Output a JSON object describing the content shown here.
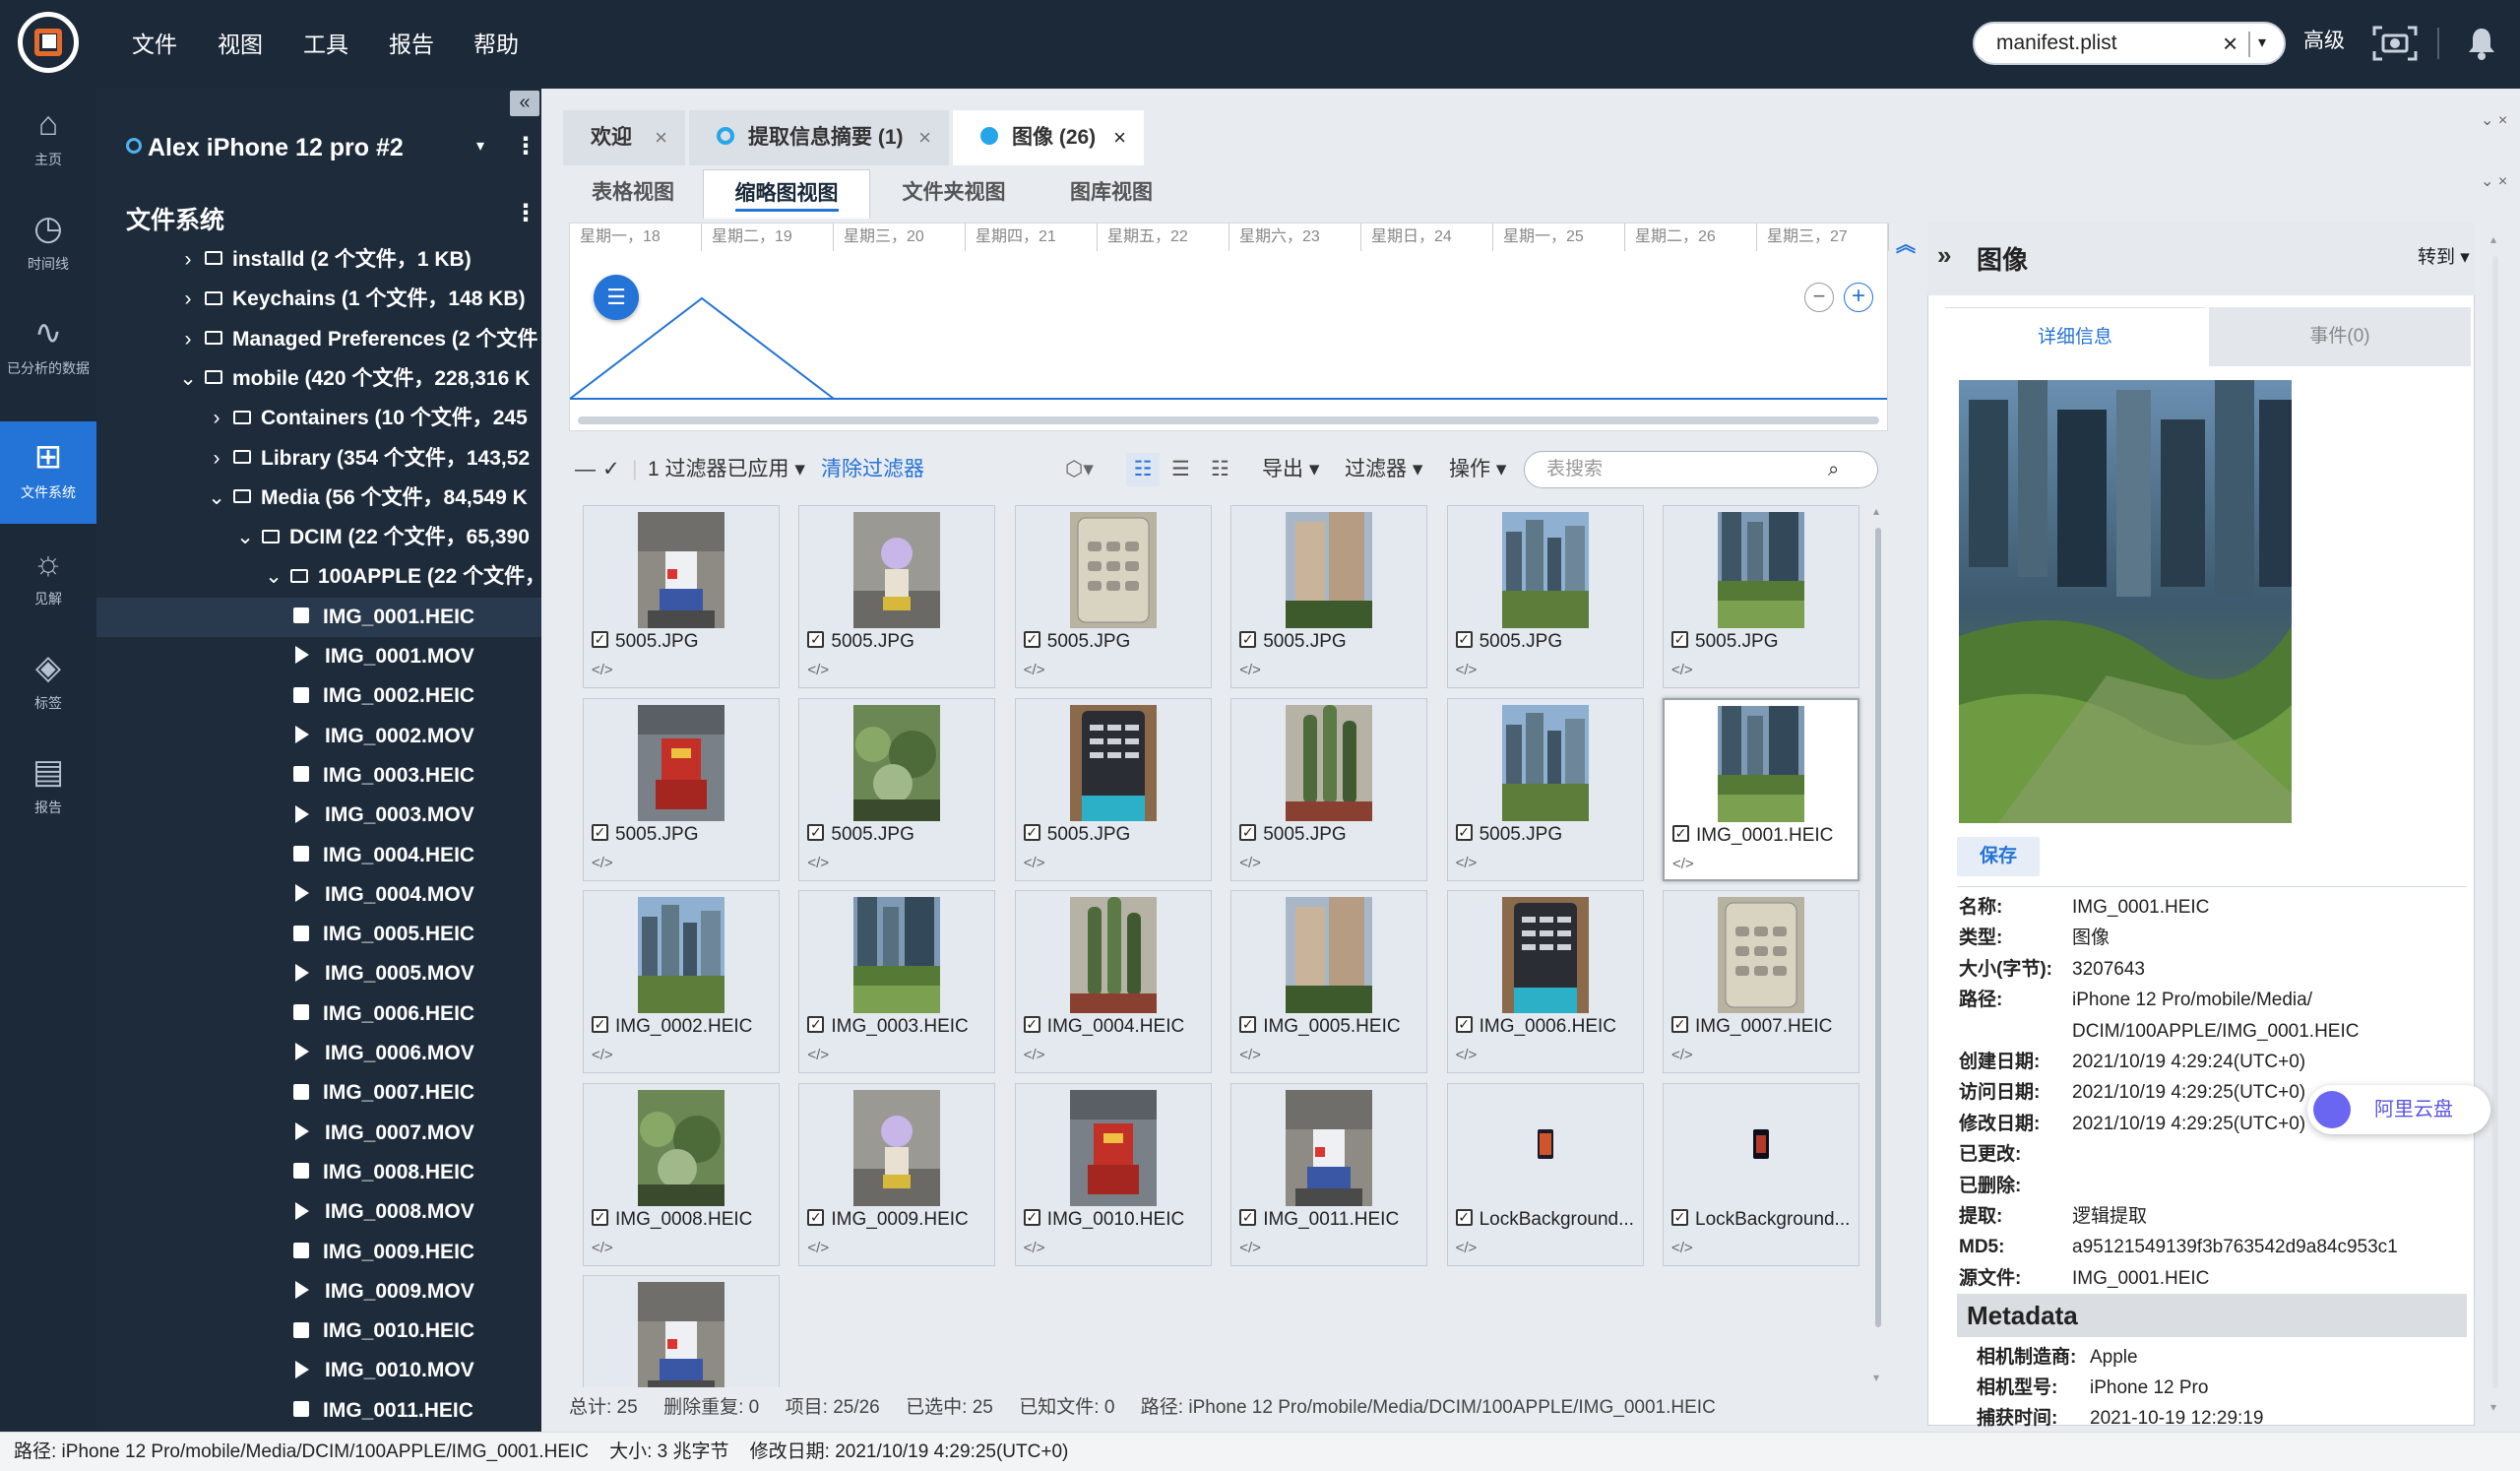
{
  "menu": [
    "文件",
    "视图",
    "工具",
    "报告",
    "帮助"
  ],
  "search": {
    "value": "manifest.plist",
    "clear": "×",
    "dropdown": "▾"
  },
  "advanced_label": "高级",
  "nav": [
    {
      "label": "主页",
      "icon": "home-icon",
      "glyph": "⌂"
    },
    {
      "label": "时间线",
      "icon": "clock-icon",
      "glyph": "◷"
    },
    {
      "label": "已分析的数据",
      "icon": "pulse-icon",
      "glyph": "∿"
    },
    {
      "label": "文件系统",
      "icon": "filesystem-icon",
      "glyph": "⊞"
    },
    {
      "label": "见解",
      "icon": "lightbulb-icon",
      "glyph": "☼"
    },
    {
      "label": "标签",
      "icon": "tag-icon",
      "glyph": "◈"
    },
    {
      "label": "报告",
      "icon": "report-icon",
      "glyph": "▤"
    }
  ],
  "device": {
    "name": "Alex iPhone 12 pro #2",
    "collapse": "«"
  },
  "filesystem_title": "文件系统",
  "tree": [
    {
      "label": "installd  (2 个文件，1 KB)",
      "indent": 0,
      "twisty": "›",
      "type": "folder"
    },
    {
      "label": "Keychains  (1 个文件，148 KB)",
      "indent": 0,
      "twisty": "›",
      "type": "folder"
    },
    {
      "label": "Managed Preferences  (2 个文件",
      "indent": 0,
      "twisty": "›",
      "type": "folder"
    },
    {
      "label": "mobile  (420 个文件，228,316 K",
      "indent": 0,
      "twisty": "⌄",
      "type": "folder"
    },
    {
      "label": "Containers  (10 个文件，245",
      "indent": 1,
      "twisty": "›",
      "type": "folder"
    },
    {
      "label": "Library  (354 个文件，143,52",
      "indent": 1,
      "twisty": "›",
      "type": "folder"
    },
    {
      "label": "Media  (56 个文件，84,549 K",
      "indent": 1,
      "twisty": "⌄",
      "type": "folder"
    },
    {
      "label": "DCIM  (22 个文件，65,390",
      "indent": 2,
      "twisty": "⌄",
      "type": "folder"
    },
    {
      "label": "100APPLE  (22 个文件，",
      "indent": 3,
      "twisty": "⌄",
      "type": "folder"
    },
    {
      "label": "IMG_0001.HEIC",
      "indent": 4,
      "twisty": "",
      "type": "image",
      "selected": true
    },
    {
      "label": "IMG_0001.MOV",
      "indent": 4,
      "twisty": "",
      "type": "video"
    },
    {
      "label": "IMG_0002.HEIC",
      "indent": 4,
      "twisty": "",
      "type": "image"
    },
    {
      "label": "IMG_0002.MOV",
      "indent": 4,
      "twisty": "",
      "type": "video"
    },
    {
      "label": "IMG_0003.HEIC",
      "indent": 4,
      "twisty": "",
      "type": "image"
    },
    {
      "label": "IMG_0003.MOV",
      "indent": 4,
      "twisty": "",
      "type": "video"
    },
    {
      "label": "IMG_0004.HEIC",
      "indent": 4,
      "twisty": "",
      "type": "image"
    },
    {
      "label": "IMG_0004.MOV",
      "indent": 4,
      "twisty": "",
      "type": "video"
    },
    {
      "label": "IMG_0005.HEIC",
      "indent": 4,
      "twisty": "",
      "type": "image"
    },
    {
      "label": "IMG_0005.MOV",
      "indent": 4,
      "twisty": "",
      "type": "video"
    },
    {
      "label": "IMG_0006.HEIC",
      "indent": 4,
      "twisty": "",
      "type": "image"
    },
    {
      "label": "IMG_0006.MOV",
      "indent": 4,
      "twisty": "",
      "type": "video"
    },
    {
      "label": "IMG_0007.HEIC",
      "indent": 4,
      "twisty": "",
      "type": "image"
    },
    {
      "label": "IMG_0007.MOV",
      "indent": 4,
      "twisty": "",
      "type": "video"
    },
    {
      "label": "IMG_0008.HEIC",
      "indent": 4,
      "twisty": "",
      "type": "image"
    },
    {
      "label": "IMG_0008.MOV",
      "indent": 4,
      "twisty": "",
      "type": "video"
    },
    {
      "label": "IMG_0009.HEIC",
      "indent": 4,
      "twisty": "",
      "type": "image"
    },
    {
      "label": "IMG_0009.MOV",
      "indent": 4,
      "twisty": "",
      "type": "video"
    },
    {
      "label": "IMG_0010.HEIC",
      "indent": 4,
      "twisty": "",
      "type": "image"
    },
    {
      "label": "IMG_0010.MOV",
      "indent": 4,
      "twisty": "",
      "type": "video"
    },
    {
      "label": "IMG_0011.HEIC",
      "indent": 4,
      "twisty": "",
      "type": "image"
    }
  ],
  "tabs": [
    {
      "label": "欢迎",
      "close": "×",
      "dot": ""
    },
    {
      "label": "提取信息摘要 (1)",
      "close": "×",
      "dot": "ring"
    },
    {
      "label": "图像 (26)",
      "close": "×",
      "dot": "filled",
      "active": true
    }
  ],
  "subtabs": [
    "表格视图",
    "缩略图视图",
    "文件夹视图",
    "图库视图"
  ],
  "timeline": {
    "days": [
      "星期一，18",
      "星期二，19",
      "星期三，20",
      "星期四，21",
      "星期五，22",
      "星期六，23",
      "星期日，24",
      "星期一，25",
      "星期二，26",
      "星期三，27"
    ],
    "zoom_out": "−",
    "zoom_in": "+"
  },
  "toolbar": {
    "filter_applied": "1 过滤器已应用",
    "clear_filter": "清除过滤器",
    "export": "导出",
    "filter": "过滤器",
    "actions": "操作",
    "search_placeholder": "表搜索"
  },
  "thumbnails": [
    {
      "label": "5005.JPG",
      "kind": "robot"
    },
    {
      "label": "5005.JPG",
      "kind": "figure"
    },
    {
      "label": "5005.JPG",
      "kind": "device"
    },
    {
      "label": "5005.JPG",
      "kind": "building"
    },
    {
      "label": "5005.JPG",
      "kind": "city"
    },
    {
      "label": "5005.JPG",
      "kind": "city2"
    },
    {
      "label": "5005.JPG",
      "kind": "red"
    },
    {
      "label": "5005.JPG",
      "kind": "plant"
    },
    {
      "label": "5005.JPG",
      "kind": "board"
    },
    {
      "label": "5005.JPG",
      "kind": "cactus"
    },
    {
      "label": "5005.JPG",
      "kind": "city"
    },
    {
      "label": "IMG_0001.HEIC",
      "kind": "city2",
      "selected": true
    },
    {
      "label": "IMG_0002.HEIC",
      "kind": "city"
    },
    {
      "label": "IMG_0003.HEIC",
      "kind": "city2"
    },
    {
      "label": "IMG_0004.HEIC",
      "kind": "cactus"
    },
    {
      "label": "IMG_0005.HEIC",
      "kind": "building"
    },
    {
      "label": "IMG_0006.HEIC",
      "kind": "board"
    },
    {
      "label": "IMG_0007.HEIC",
      "kind": "device"
    },
    {
      "label": "IMG_0008.HEIC",
      "kind": "plant"
    },
    {
      "label": "IMG_0009.HEIC",
      "kind": "figure"
    },
    {
      "label": "IMG_0010.HEIC",
      "kind": "red"
    },
    {
      "label": "IMG_0011.HEIC",
      "kind": "robot"
    },
    {
      "label": "LockBackground...",
      "kind": "small"
    },
    {
      "label": "LockBackground...",
      "kind": "small2"
    },
    {
      "label": "",
      "kind": "robot"
    }
  ],
  "grid_status": {
    "total": "总计: 25",
    "dups": "删除重复: 0",
    "items": "项目: 25/26",
    "selected": "已选中: 25",
    "known": "已知文件:  0",
    "path": "路径: iPhone 12 Pro/mobile/Media/DCIM/100APPLE/IMG_0001.HEIC"
  },
  "detail": {
    "title": "图像",
    "goto": "转到",
    "tab_info": "详细信息",
    "tab_events": "事件(0)",
    "save": "保存",
    "fields": [
      {
        "k": "名称:",
        "v": "IMG_0001.HEIC"
      },
      {
        "k": "类型:",
        "v": "图像"
      },
      {
        "k": "大小(字节):",
        "v": "3207643"
      },
      {
        "k": "路径:",
        "v": "iPhone 12 Pro/mobile/Media/"
      },
      {
        "k": "",
        "v": "DCIM/100APPLE/IMG_0001.HEIC"
      },
      {
        "k": "创建日期:",
        "v": "2021/10/19 4:29:24(UTC+0)"
      },
      {
        "k": "访问日期:",
        "v": "2021/10/19 4:29:25(UTC+0)"
      },
      {
        "k": "修改日期:",
        "v": "2021/10/19 4:29:25(UTC+0)"
      },
      {
        "k": "已更改:",
        "v": ""
      },
      {
        "k": "已删除:",
        "v": ""
      },
      {
        "k": "提取:",
        "v": "逻辑提取"
      },
      {
        "k": "MD5:",
        "v": "a95121549139f3b763542d9a84c953c1"
      },
      {
        "k": "源文件:",
        "v": "IMG_0001.HEIC"
      }
    ],
    "metadata_title": "Metadata",
    "metadata": [
      {
        "k": "相机制造商:",
        "v": "Apple"
      },
      {
        "k": "相机型号:",
        "v": "iPhone 12 Pro"
      },
      {
        "k": "捕获时间:",
        "v": "2021-10-19 12:29:19"
      }
    ]
  },
  "aliyun": "阿里云盘",
  "bottom": {
    "path": "路径: iPhone 12 Pro/mobile/Media/DCIM/100APPLE/IMG_0001.HEIC",
    "size": "大小: 3 兆字节",
    "modified": "修改日期: 2021/10/19 4:29:25(UTC+0)"
  },
  "colors": {
    "accent": "#2473d6",
    "topbar": "#1c2939",
    "orange": "#e66a2c"
  }
}
